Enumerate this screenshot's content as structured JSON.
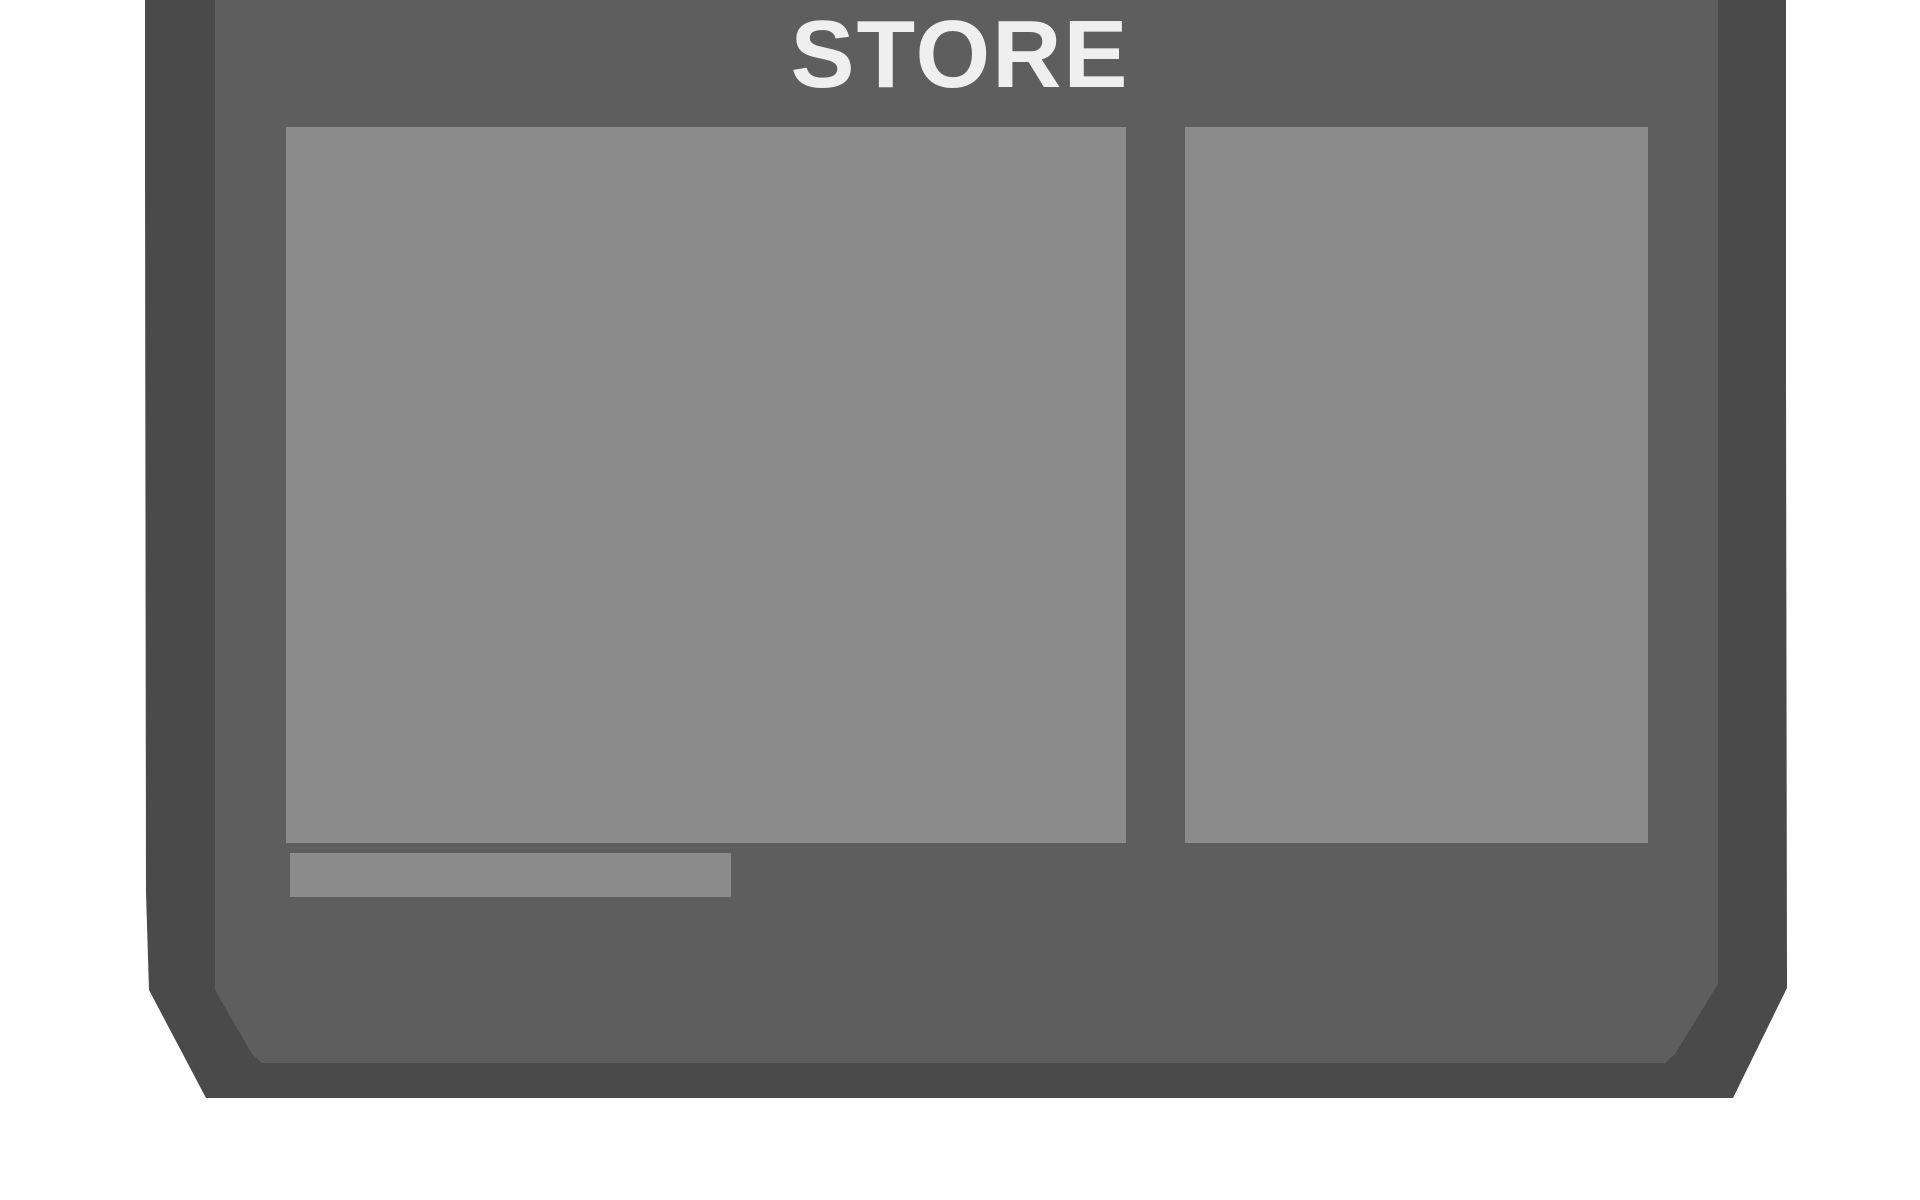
{
  "title": "STORE",
  "colors": {
    "page_background": "#ffffff",
    "frame_outer": "#4a4a4a",
    "frame_inner": "#5e5e5e",
    "panel": "#8b8b8b",
    "title_text": "#efefef"
  },
  "panels": {
    "main": {
      "icon": "image-placeholder"
    },
    "side": {
      "icon": "image-placeholder"
    },
    "caption": {
      "icon": "text-placeholder-bar"
    }
  }
}
